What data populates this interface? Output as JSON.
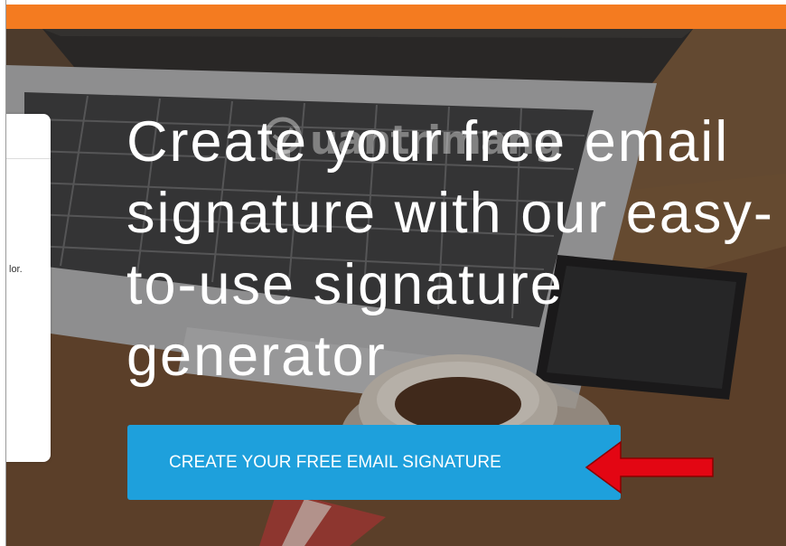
{
  "side_card": {
    "text": "lor."
  },
  "watermark": {
    "text": "uantrimang"
  },
  "hero": {
    "headline": "Create your free email signature with our easy-to-use signature generator",
    "cta_label": "CREATE YOUR FREE EMAIL SIGNATURE"
  },
  "colors": {
    "top_bar": "#f47b20",
    "cta_background": "#1ea0dc",
    "annotation_arrow": "#e30613"
  },
  "icons": {
    "annotation": "red-arrow-left-icon",
    "watermark": "lightbulb-icon"
  }
}
